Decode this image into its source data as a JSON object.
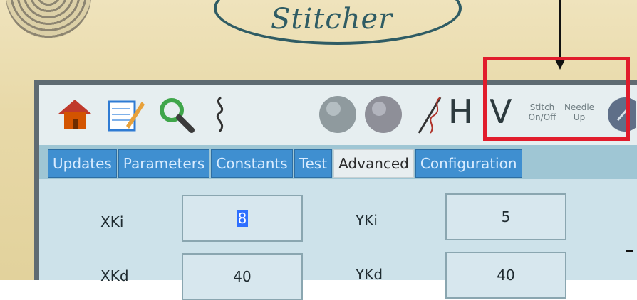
{
  "brand": {
    "logo_text": "Stitcher"
  },
  "toolbar": {
    "icons": [
      "home-icon",
      "edit-pencil-icon",
      "search-magnifier-icon",
      "stitch-squiggle-icon",
      "gray-ball-button-1",
      "gray-ball-button-2",
      "needle-thread-icon"
    ],
    "h_label": "H",
    "v_label": "V",
    "stitch_toggle_line1": "Stitch",
    "stitch_toggle_line2": "On/Off",
    "needle_line1": "Needle",
    "needle_line2": "Up"
  },
  "tabs": [
    {
      "label": "Updates",
      "active": false
    },
    {
      "label": "Parameters",
      "active": false
    },
    {
      "label": "Constants",
      "active": false
    },
    {
      "label": "Test",
      "active": false
    },
    {
      "label": "Advanced",
      "active": true
    },
    {
      "label": "Configuration",
      "active": false
    }
  ],
  "fields": {
    "xki": {
      "label": "XKi",
      "value": "8"
    },
    "yki": {
      "label": "YKi",
      "value": "5"
    },
    "xkd": {
      "label": "XKd",
      "value": "40"
    },
    "ykd": {
      "label": "YKd",
      "value": "40"
    }
  },
  "colors": {
    "highlight": "#e11c2c",
    "tab_blue": "#3f8fd0",
    "screen_bg": "#9fc6d4"
  }
}
